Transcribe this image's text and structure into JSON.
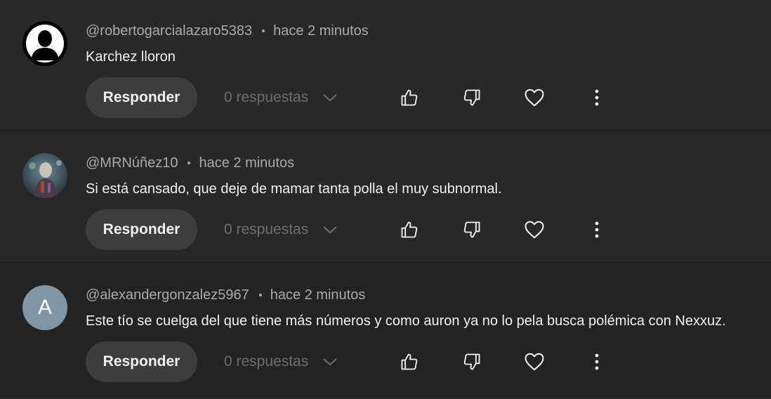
{
  "comments": [
    {
      "author": "@robertogarcialazaro5383",
      "time": "hace 2 minutos",
      "text": "Karchez lloron",
      "reply_label": "Responder",
      "replies_label": "0 respuestas"
    },
    {
      "author": "@MRNúñez10",
      "time": "hace 2 minutos",
      "text": "Si está cansado, que deje de mamar tanta polla el muy subnormal.",
      "reply_label": "Responder",
      "replies_label": "0 respuestas"
    },
    {
      "author": "@alexandergonzalez5967",
      "time": "hace 2 minutos",
      "text": "Este tío se cuelga del que tiene más números y como auron ya no lo pela busca polémica con Nexxuz.",
      "reply_label": "Responder",
      "replies_label": "0 respuestas",
      "avatar_letter": "A",
      "avatar_color": "#8295a4"
    }
  ],
  "icons": {
    "like": "thumbs-up-icon",
    "dislike": "thumbs-down-icon",
    "heart": "heart-icon",
    "more": "more-vert-icon",
    "chevron": "chevron-down-icon"
  },
  "colors": {
    "background": "#282828",
    "text": "#f1f1f1",
    "meta": "#aaaaaa",
    "reply_button": "#3d3d3d"
  }
}
